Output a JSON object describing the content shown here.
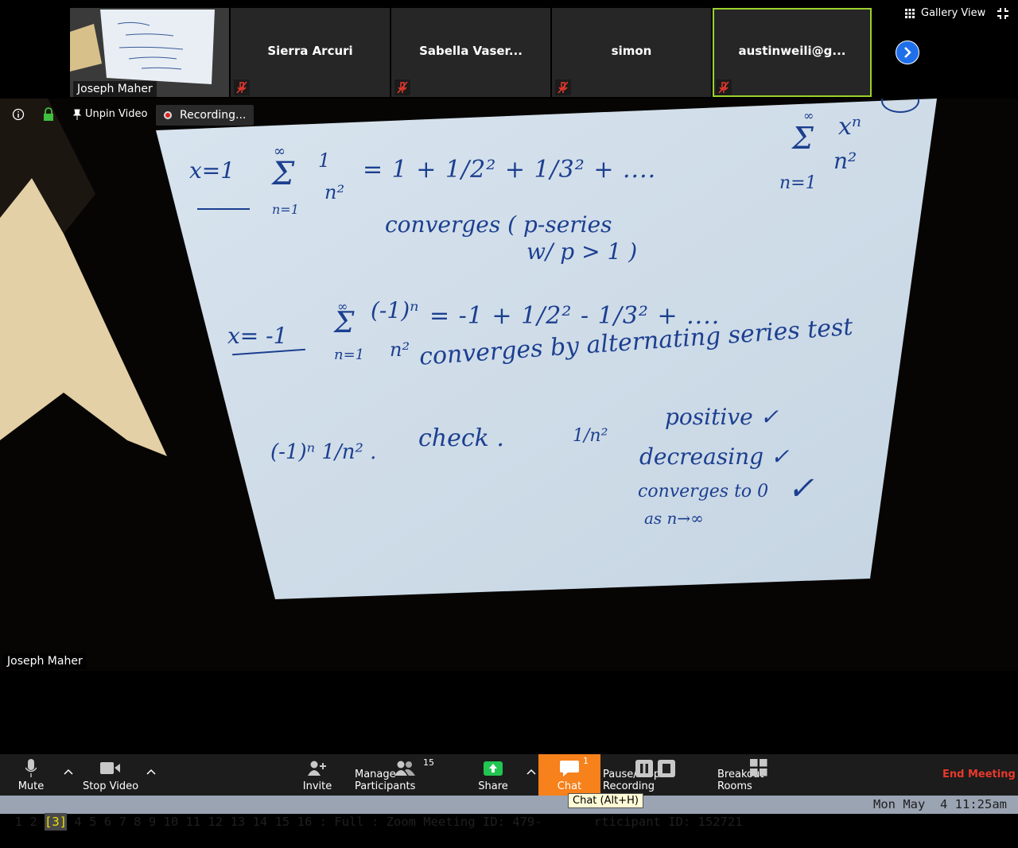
{
  "strip": {
    "self": {
      "name": "Joseph Maher"
    },
    "participants": [
      {
        "name": "Sierra Arcuri",
        "muted": true,
        "active": false
      },
      {
        "name": "Sabella Vaser...",
        "muted": true,
        "active": false
      },
      {
        "name": "simon",
        "muted": true,
        "active": false
      },
      {
        "name": "austinweili@g...",
        "muted": true,
        "active": true
      }
    ],
    "gallery_view_label": "Gallery View"
  },
  "video": {
    "unpin_label": "Unpin Video",
    "recording_label": "Recording...",
    "speaker_name": "Joseph Maher",
    "board": {
      "section1": {
        "case": "x=1",
        "sum_top": "∞",
        "sum_bottom": "n=1",
        "term_num": "1",
        "term_den": "n²",
        "expansion": "= 1 + 1/2² + 1/3² + ....",
        "note_line1": "converges ( p-series",
        "note_line2": "w/ p > 1 )"
      },
      "corner": {
        "sum_top": "∞",
        "sum_bottom": "n=1",
        "num": "xⁿ",
        "den": "n²"
      },
      "section2": {
        "case": "x= -1",
        "sum_top": "∞",
        "sum_bottom": "n=1",
        "term_num": "(-1)ⁿ",
        "term_den": "n²",
        "expansion": "= -1 + 1/2² - 1/3² + ....",
        "note": "converges by alternating series test"
      },
      "check": {
        "term": "(-1)ⁿ 1/n² .",
        "label": "check .",
        "fraction": "1/n²",
        "items": [
          "positive ✓",
          "decreasing ✓",
          "converges to 0",
          "as n→∞"
        ],
        "last_tick": "✓"
      }
    }
  },
  "toolbar": {
    "mute": "Mute",
    "stop_video": "Stop Video",
    "invite": "Invite",
    "manage_participants": "Manage Participants",
    "participants_count": "15",
    "share": "Share",
    "chat": "Chat",
    "chat_badge": "1",
    "recording": "Pause/Stop Recording",
    "breakout": "Breakout Rooms",
    "end": "End Meeting",
    "chat_tooltip": "Chat (Alt+H)"
  },
  "statusbar": {
    "workspaces": [
      "1",
      "2",
      "3",
      "4",
      "5",
      "6",
      "7",
      "8",
      "9",
      "10",
      "11",
      "12",
      "13",
      "14",
      "15",
      "16"
    ],
    "current_workspace": "3",
    "text": ": Full : Zoom Meeting ID: 479-       rticipant ID: 152721",
    "clock": "Mon May  4 11:25am"
  },
  "colors": {
    "ink": "#1c3f8f",
    "chat_accent": "#f7811b",
    "end_meeting": "#e8392c",
    "active_border": "#9bd12c",
    "statusbar": "#9aa4b3"
  }
}
